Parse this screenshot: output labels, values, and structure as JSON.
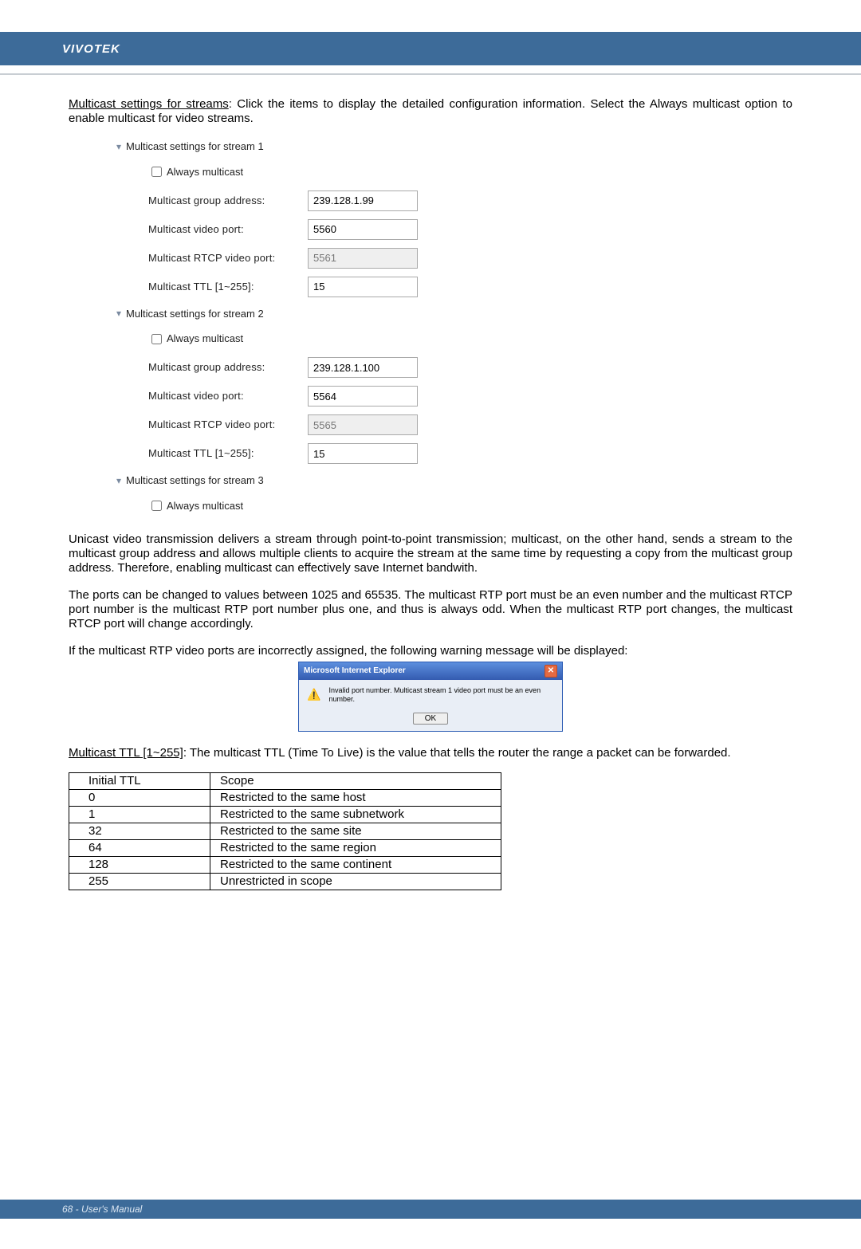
{
  "brand": "VIVOTEK",
  "intro": {
    "lead_u": "Multicast settings for streams",
    "lead_rest": ": Click the items to display the detailed configuration information. Select the Always multicast option to enable multicast for video streams."
  },
  "stream_groups": [
    {
      "title": "Multicast settings for stream 1",
      "always_label": "Always multicast",
      "rows": {
        "group_addr": {
          "label": "Multicast group address:",
          "value": "239.128.1.99",
          "readonly": false
        },
        "video_port": {
          "label": "Multicast video port:",
          "value": "5560",
          "readonly": false
        },
        "rtcp_port": {
          "label": "Multicast RTCP video port:",
          "value": "5561",
          "readonly": true
        },
        "ttl": {
          "label": "Multicast TTL [1~255]:",
          "value": "15",
          "readonly": false
        }
      }
    },
    {
      "title": "Multicast settings for stream 2",
      "always_label": "Always multicast",
      "rows": {
        "group_addr": {
          "label": "Multicast group address:",
          "value": "239.128.1.100",
          "readonly": false
        },
        "video_port": {
          "label": "Multicast video port:",
          "value": "5564",
          "readonly": false
        },
        "rtcp_port": {
          "label": "Multicast RTCP video port:",
          "value": "5565",
          "readonly": true
        },
        "ttl": {
          "label": "Multicast TTL [1~255]:",
          "value": "15",
          "readonly": false
        }
      }
    },
    {
      "title": "Multicast settings for stream 3",
      "always_label": "Always multicast"
    }
  ],
  "para1": "Unicast video transmission delivers a stream through point-to-point transmission; multicast, on the other hand, sends a stream to the multicast group address and allows multiple clients to acquire the stream at the same time by requesting a copy from the multicast group address. Therefore, enabling multicast can effectively save Internet bandwith.",
  "para2": "The ports can be changed to values between 1025 and 65535. The multicast RTP port must be an even number and the multicast RTCP port number is the multicast RTP port number plus one, and thus is always odd. When the multicast RTP port changes, the multicast RTCP port will change accordingly.",
  "para3": "If the multicast RTP video ports are incorrectly assigned, the following warning message will be displayed:",
  "dialog": {
    "title": "Microsoft Internet Explorer",
    "message": "Invalid port number. Multicast stream 1 video port must be an even number.",
    "ok": "OK"
  },
  "ttl_desc": {
    "lead_u": "Multicast TTL [1~255]",
    "lead_rest": ": The multicast TTL (Time To Live) is the value that tells the router the range a packet can be forwarded."
  },
  "ttl_table": {
    "headers": [
      "Initial TTL",
      "Scope"
    ],
    "rows": [
      [
        "0",
        "Restricted to the same host"
      ],
      [
        "1",
        "Restricted to the same subnetwork"
      ],
      [
        "32",
        "Restricted to the same site"
      ],
      [
        "64",
        "Restricted to the same region"
      ],
      [
        "128",
        "Restricted to the same continent"
      ],
      [
        "255",
        "Unrestricted in scope"
      ]
    ]
  },
  "footer": "68 - User's Manual"
}
